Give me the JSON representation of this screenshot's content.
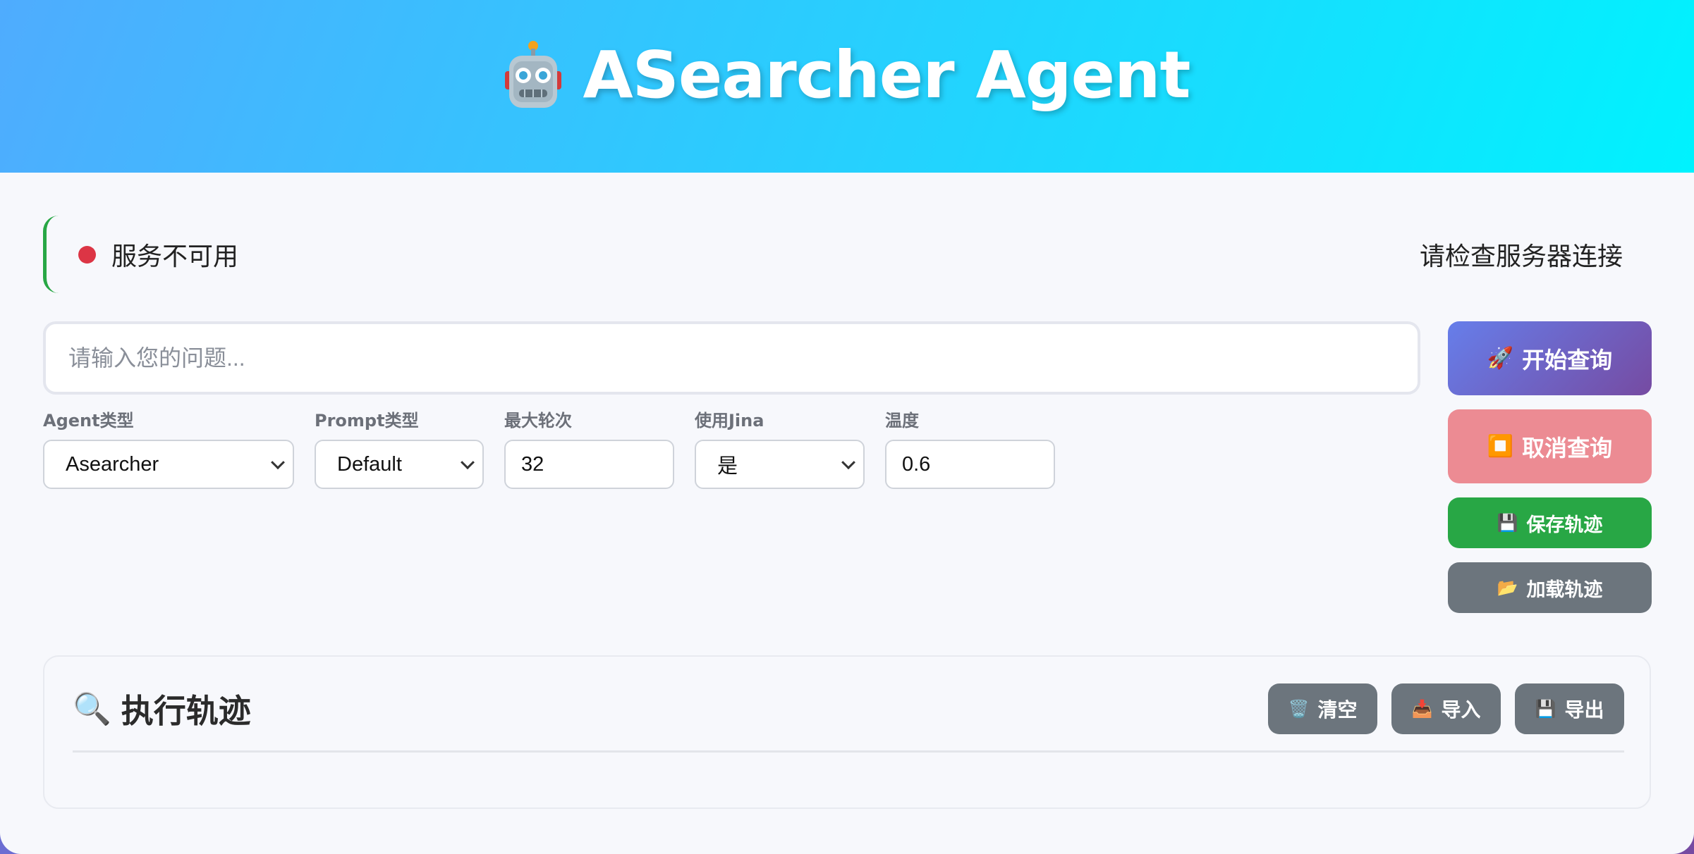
{
  "header": {
    "title": "ASearcher Agent",
    "icon": "robot-icon"
  },
  "status": {
    "dot_color": "#dc3545",
    "text": "服务不可用",
    "hint": "请检查服务器连接"
  },
  "query": {
    "placeholder": "请输入您的问题..."
  },
  "settings": {
    "agent_type": {
      "label": "Agent类型",
      "value": "Asearcher"
    },
    "prompt_type": {
      "label": "Prompt类型",
      "value": "Default"
    },
    "max_turns": {
      "label": "最大轮次",
      "value": "32"
    },
    "use_jina": {
      "label": "使用Jina",
      "value": "是"
    },
    "temperature": {
      "label": "温度",
      "value": "0.6"
    }
  },
  "actions": {
    "start": {
      "label": "开始查询",
      "icon": "rocket-icon"
    },
    "cancel": {
      "label": "取消查询",
      "icon": "stop-icon"
    },
    "save_trace": {
      "label": "保存轨迹",
      "icon": "floppy-disk-icon"
    },
    "load_trace": {
      "label": "加载轨迹",
      "icon": "folder-icon"
    }
  },
  "trace": {
    "title": "执行轨迹",
    "icon": "magnifier-icon",
    "clear": {
      "label": "清空",
      "icon": "trash-icon"
    },
    "import": {
      "label": "导入",
      "icon": "inbox-icon"
    },
    "export": {
      "label": "导出",
      "icon": "floppy-disk-icon"
    }
  },
  "colors": {
    "accent": "#667eea",
    "success": "#28a745",
    "danger": "#dc3545",
    "secondary": "#6c757d"
  }
}
